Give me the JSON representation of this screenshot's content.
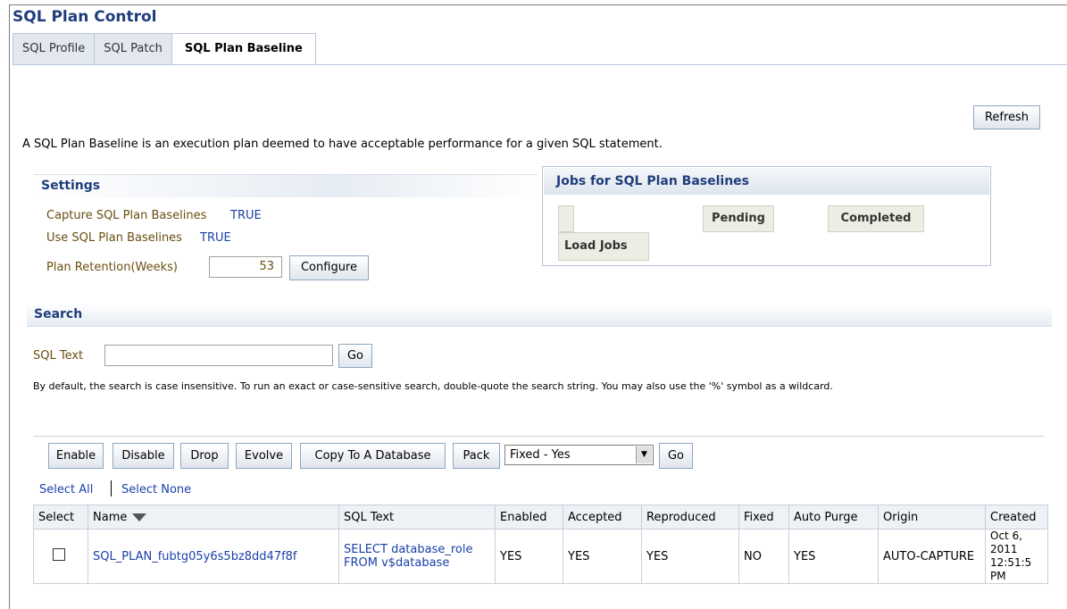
{
  "page": {
    "title": "SQL Plan Control",
    "tabs": [
      {
        "label": "SQL Profile",
        "active": false
      },
      {
        "label": "SQL Patch",
        "active": false
      },
      {
        "label": "SQL Plan Baseline",
        "active": true
      }
    ],
    "refresh_label": "Refresh",
    "description": "A SQL Plan Baseline is an execution plan deemed to have acceptable performance for a given SQL statement."
  },
  "settings": {
    "header": "Settings",
    "capture_label": "Capture SQL Plan Baselines",
    "capture_value": "TRUE",
    "use_label": "Use SQL Plan Baselines",
    "use_value": "TRUE",
    "retention_label": "Plan Retention(Weeks)",
    "retention_value": "53",
    "configure_label": "Configure"
  },
  "jobs": {
    "header": "Jobs for SQL Plan Baselines",
    "pending_label": "Pending",
    "completed_label": "Completed",
    "load_jobs_label": "Load Jobs"
  },
  "search": {
    "header": "Search",
    "sql_text_label": "SQL Text",
    "sql_text_value": "",
    "go_label": "Go",
    "hint": "By default, the search is case insensitive. To run an exact or case-sensitive search, double-quote the search string. You may also use the '%' symbol as a wildcard."
  },
  "toolbar": {
    "enable": "Enable",
    "disable": "Disable",
    "drop": "Drop",
    "evolve": "Evolve",
    "copy": "Copy To A Database",
    "pack": "Pack",
    "filter_selected": "Fixed - Yes",
    "go": "Go",
    "select_all": "Select All",
    "select_none": "Select None"
  },
  "table": {
    "headers": [
      "Select",
      "Name",
      "SQL Text",
      "Enabled",
      "Accepted",
      "Reproduced",
      "Fixed",
      "Auto Purge",
      "Origin",
      "Created"
    ],
    "rows": [
      {
        "name": "SQL_PLAN_fubtg05y6s5bz8dd47f8f",
        "sql_text": "SELECT database_role FROM v$database",
        "enabled": "YES",
        "accepted": "YES",
        "reproduced": "YES",
        "fixed": "NO",
        "auto_purge": "YES",
        "origin": "AUTO-CAPTURE",
        "created": "Oct 6, 2011 12:51:5",
        "created_extra": "PM"
      }
    ]
  },
  "colors": {
    "title": "#1f3d7a",
    "link": "#1a3fa8",
    "label": "#6a4f10"
  }
}
